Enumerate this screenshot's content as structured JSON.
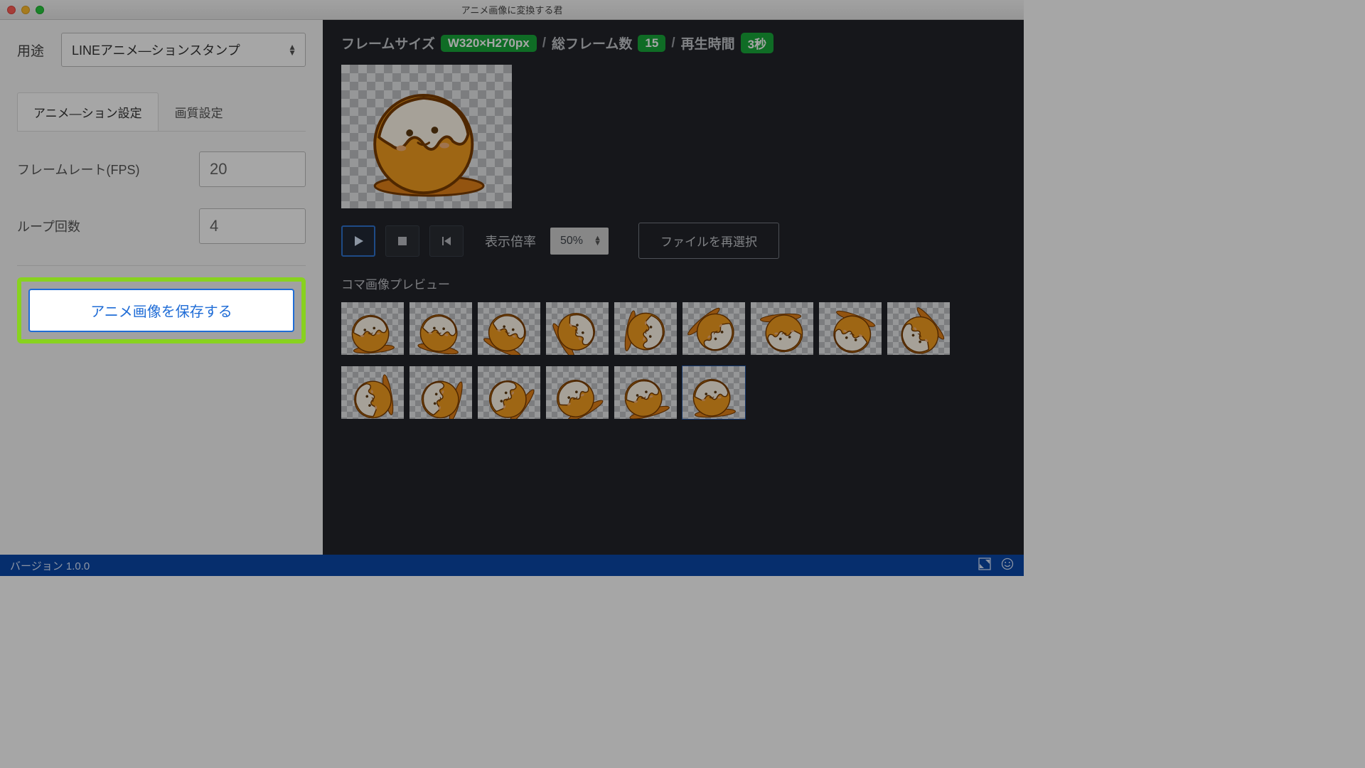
{
  "window": {
    "title": "アニメ画像に変換する君"
  },
  "sidebar": {
    "purpose_label": "用途",
    "purpose_value": "LINEアニメ―ションスタンプ",
    "tabs": {
      "anim": "アニメ―ション設定",
      "quality": "画質設定"
    },
    "fps_label": "フレームレート(FPS)",
    "fps_value": "20",
    "loop_label": "ループ回数",
    "loop_value": "4",
    "save_label": "アニメ画像を保存する"
  },
  "preview": {
    "frame_size_label": "フレームサイズ",
    "frame_size_value": "W320×H270px",
    "total_frames_label": "総フレーム数",
    "total_frames_value": "15",
    "duration_label": "再生時間",
    "duration_value": "3秒",
    "zoom_label": "表示倍率",
    "zoom_value": "50%",
    "reselect_label": "ファイルを再選択",
    "frames_title": "コマ画像プレビュー",
    "slash": "/"
  },
  "footer": {
    "version": "バージョン 1.0.0"
  }
}
